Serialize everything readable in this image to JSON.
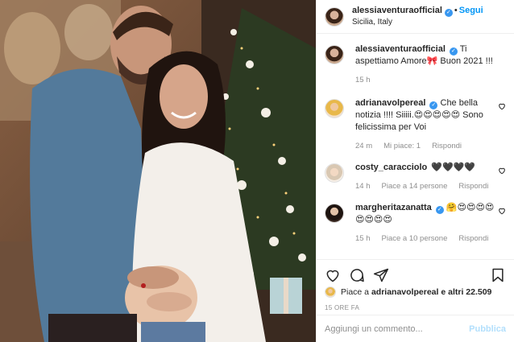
{
  "post": {
    "author": "alessiaventuraofficial",
    "follow_label": "Segui",
    "location": "Sicilia, Italy",
    "caption": "Ti aspettiamo Amore🎀 Buon 2021 !!!",
    "caption_time": "15 h"
  },
  "comments": [
    {
      "username": "adrianavolpereal",
      "text": "Che bella notizia !!!! Siiiii.😍😍😍😍😍 Sono felicissima per Voi",
      "time": "24 m",
      "likes": "Mi piace: 1",
      "reply": "Rispondi"
    },
    {
      "username": "costy_caracciolo",
      "text": "🖤🖤🖤🖤",
      "time": "14 h",
      "likes": "Piace a 14 persone",
      "reply": "Rispondi"
    },
    {
      "username": "margheritazanatta",
      "text": "🤗😍😍😍😍😍😍😍😍",
      "time": "15 h",
      "likes": "Piace a 10 persone",
      "reply": "Rispondi"
    }
  ],
  "likes_summary": {
    "prefix": "Piace a",
    "user": "adrianavolpereal",
    "suffix": "e altri 22.509"
  },
  "timestamp": "15 ORE FA",
  "add_comment": {
    "placeholder": "Aggiungi un commento...",
    "publish_label": "Pubblica"
  },
  "colors": {
    "link": "#0095f6",
    "verified": "#3897f0",
    "muted": "#8e8e8e",
    "publish_disabled": "#b2dffc"
  }
}
